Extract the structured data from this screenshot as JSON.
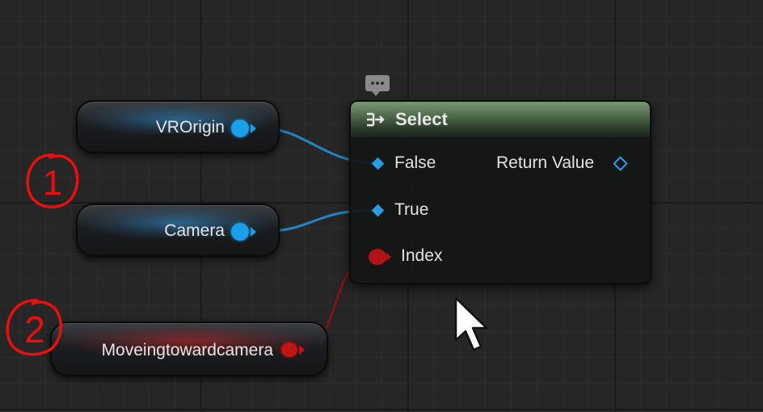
{
  "graph": {
    "variables": {
      "vr_origin": {
        "label": "VROrigin"
      },
      "camera": {
        "label": "Camera"
      },
      "moving": {
        "label": "Moveingtowardcamera"
      }
    },
    "select_node": {
      "title": "Select",
      "pins": {
        "false_label": "False",
        "true_label": "True",
        "index_label": "Index",
        "return_label": "Return Value"
      }
    }
  },
  "annotations": {
    "marker_1": "1",
    "marker_2": "2"
  },
  "colors": {
    "object_pin": "#19a0ea",
    "bool_pin": "#c01515",
    "select_header": "#4f6b4b",
    "annotation_ink": "#e8100c"
  },
  "icons": {
    "select": "select-node-icon",
    "comment": "comment-bubble-icon",
    "cursor": "mouse-cursor-icon"
  }
}
